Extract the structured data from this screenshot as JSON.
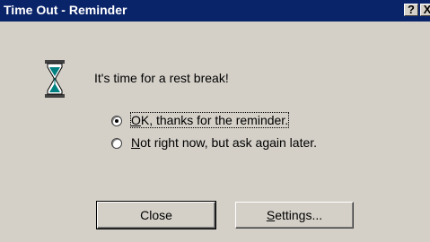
{
  "window": {
    "title": "Time Out - Reminder",
    "help_button": "?",
    "close_button": "X"
  },
  "icon": "hourglass-icon",
  "message": "It's time for a rest break!",
  "options": [
    {
      "access_key": "O",
      "rest": "K, thanks for the reminder.",
      "selected": true
    },
    {
      "access_key": "N",
      "rest": "ot right now, but ask again later.",
      "selected": false
    }
  ],
  "buttons": {
    "close_label": "Close",
    "settings_key": "S",
    "settings_rest": "ettings..."
  }
}
